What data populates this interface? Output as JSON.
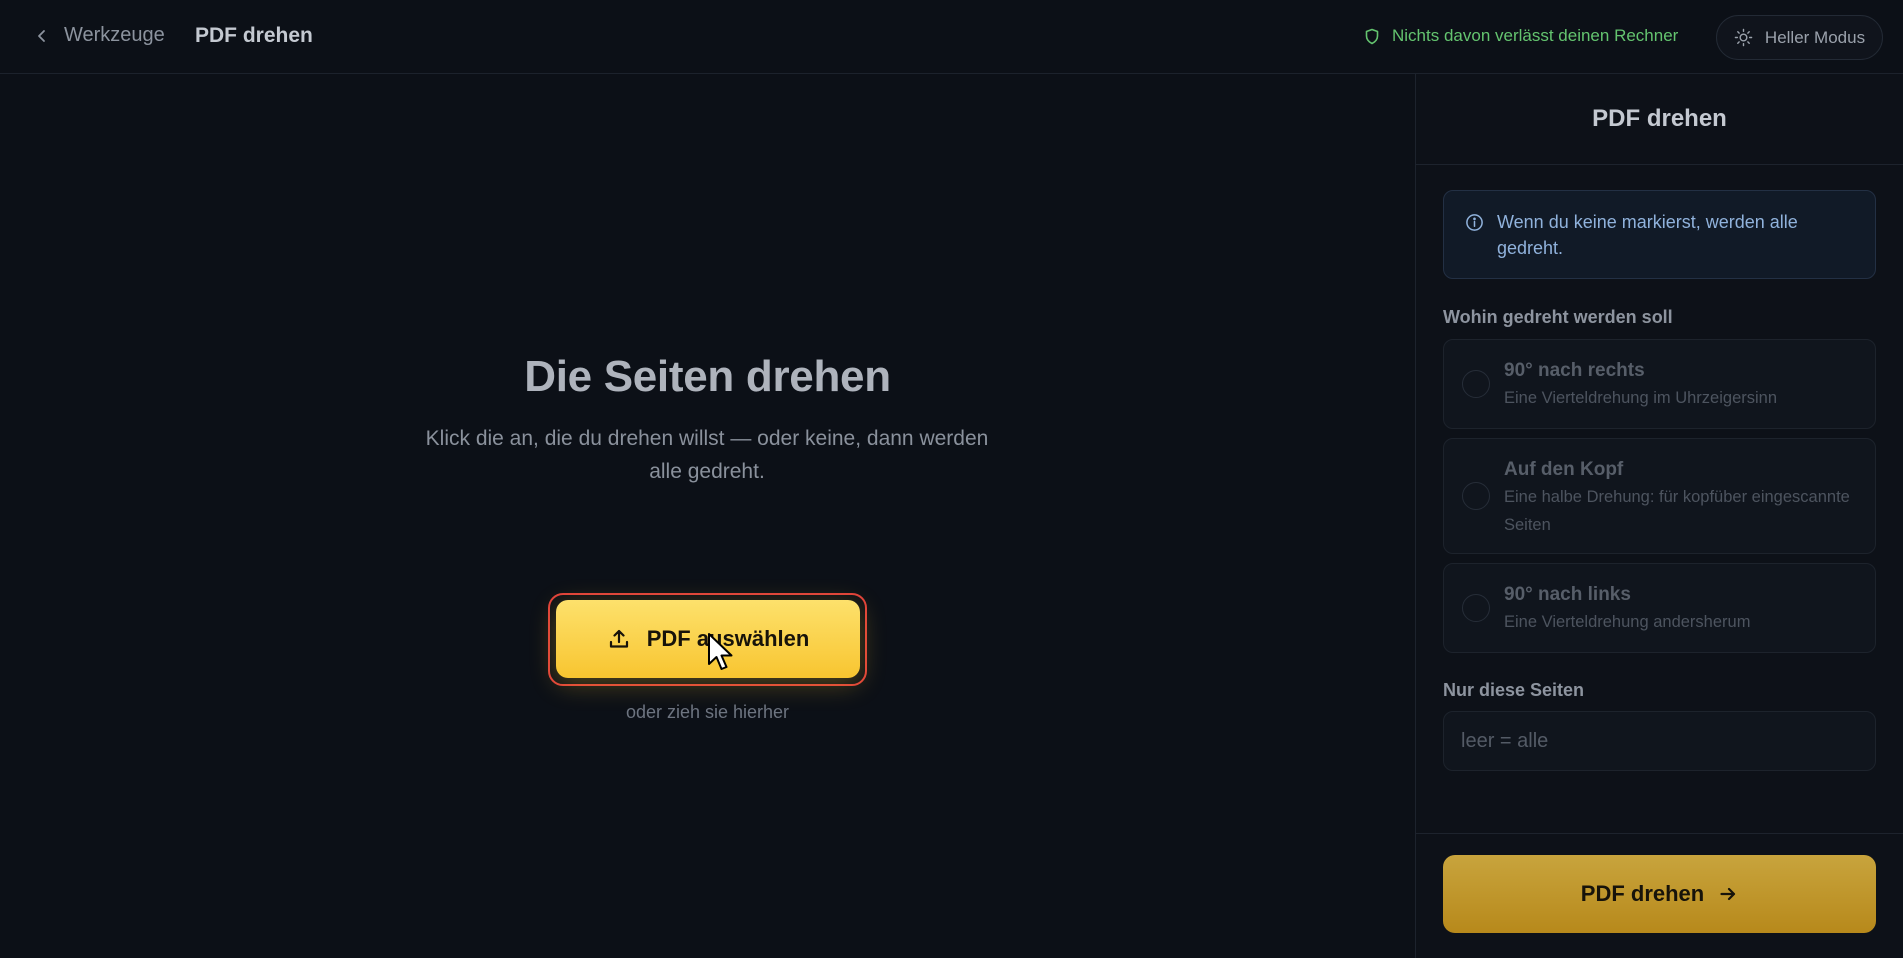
{
  "header": {
    "back_label": "Werkzeuge",
    "title": "PDF drehen",
    "privacy_note": "Nichts davon verlässt deinen Rechner",
    "theme_toggle_label": "Heller Modus"
  },
  "main": {
    "title": "Die Seiten drehen",
    "subtitle": "Klick die an, die du drehen willst — oder keine, dann werden alle gedreht.",
    "upload_button_label": "PDF auswählen",
    "drop_hint": "oder zieh sie hierher"
  },
  "sidebar": {
    "title": "PDF drehen",
    "info_text": "Wenn du keine markierst, werden alle gedreht.",
    "direction_label": "Wohin gedreht werden soll",
    "options": [
      {
        "title": "90° nach rechts",
        "description": "Eine Vierteldrehung im Uhrzeigersinn"
      },
      {
        "title": "Auf den Kopf",
        "description": "Eine halbe Drehung: für kopfüber eingescannte Seiten"
      },
      {
        "title": "90° nach links",
        "description": "Eine Vierteldrehung andersherum"
      }
    ],
    "pages_label": "Nur diese Seiten",
    "pages_input": {
      "value": "",
      "placeholder": "leer = alle"
    },
    "submit_label": "PDF drehen"
  },
  "colors": {
    "background": "#0c1017",
    "accent_yellow": "#f8c530",
    "privacy_green": "#64c46f",
    "info_blue": "#90b2dc",
    "focus_red": "#e0413b"
  }
}
